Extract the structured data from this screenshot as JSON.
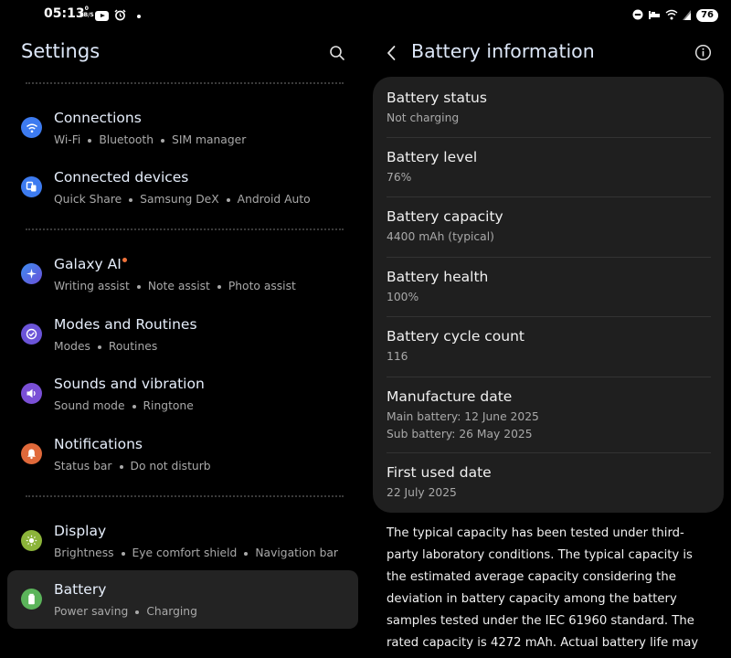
{
  "status_bar": {
    "time": "05:13",
    "net_speed_value": "0",
    "net_speed_unit": "KB/S",
    "battery_level": "76",
    "icons_left": [
      "youtube-icon",
      "alarm-icon",
      "dot-icon"
    ],
    "icons_right": [
      "do-not-disturb-icon",
      "sleep-mode-icon",
      "wifi-icon",
      "signal-icon",
      "battery-icon"
    ]
  },
  "settings": {
    "title": "Settings",
    "items": [
      {
        "name": "connections",
        "title": "Connections",
        "subtitle": [
          "Wi-Fi",
          "Bluetooth",
          "SIM manager"
        ],
        "icon": "wifi-icon",
        "color": "#3d7bf0"
      },
      {
        "name": "connected-devices",
        "title": "Connected devices",
        "subtitle": [
          "Quick Share",
          "Samsung DeX",
          "Android Auto"
        ],
        "icon": "devices-icon",
        "color": "#3d7bf0"
      },
      {
        "name": "galaxy-ai",
        "title": "Galaxy AI",
        "subtitle": [
          "Writing assist",
          "Note assist",
          "Photo assist"
        ],
        "icon": "sparkle-icon",
        "color": "#4f6fe8",
        "badge": true
      },
      {
        "name": "modes-and-routines",
        "title": "Modes and Routines",
        "subtitle": [
          "Modes",
          "Routines"
        ],
        "icon": "check-circle-icon",
        "color": "#6b54d8"
      },
      {
        "name": "sounds-and-vibration",
        "title": "Sounds and vibration",
        "subtitle": [
          "Sound mode",
          "Ringtone"
        ],
        "icon": "speaker-icon",
        "color": "#7a4fd6"
      },
      {
        "name": "notifications",
        "title": "Notifications",
        "subtitle": [
          "Status bar",
          "Do not disturb"
        ],
        "icon": "bell-icon",
        "color": "#e0693a"
      },
      {
        "name": "display",
        "title": "Display",
        "subtitle": [
          "Brightness",
          "Eye comfort shield",
          "Navigation bar"
        ],
        "icon": "sun-icon",
        "color": "#8cb43a"
      },
      {
        "name": "battery",
        "title": "Battery",
        "subtitle": [
          "Power saving",
          "Charging"
        ],
        "icon": "battery-icon",
        "color": "#5bb45a",
        "selected": true
      }
    ]
  },
  "battery_info": {
    "title": "Battery information",
    "rows": [
      {
        "title": "Battery status",
        "values": [
          "Not charging"
        ]
      },
      {
        "title": "Battery level",
        "values": [
          "76%"
        ]
      },
      {
        "title": "Battery capacity",
        "values": [
          "4400 mAh (typical)"
        ]
      },
      {
        "title": "Battery health",
        "values": [
          "100%"
        ]
      },
      {
        "title": "Battery cycle count",
        "values": [
          "116"
        ]
      },
      {
        "title": "Manufacture date",
        "values": [
          "Main battery: 12 June 2025",
          "Sub battery: 26 May 2025"
        ]
      },
      {
        "title": "First used date",
        "values": [
          "22 July 2025"
        ]
      }
    ],
    "note": "The typical capacity has been tested under third-party laboratory conditions. The typical capacity is the estimated average capacity considering the deviation in battery capacity among the battery samples tested under the IEC 61960 standard. The rated capacity is 4272 mAh. Actual battery life may vary depending"
  }
}
